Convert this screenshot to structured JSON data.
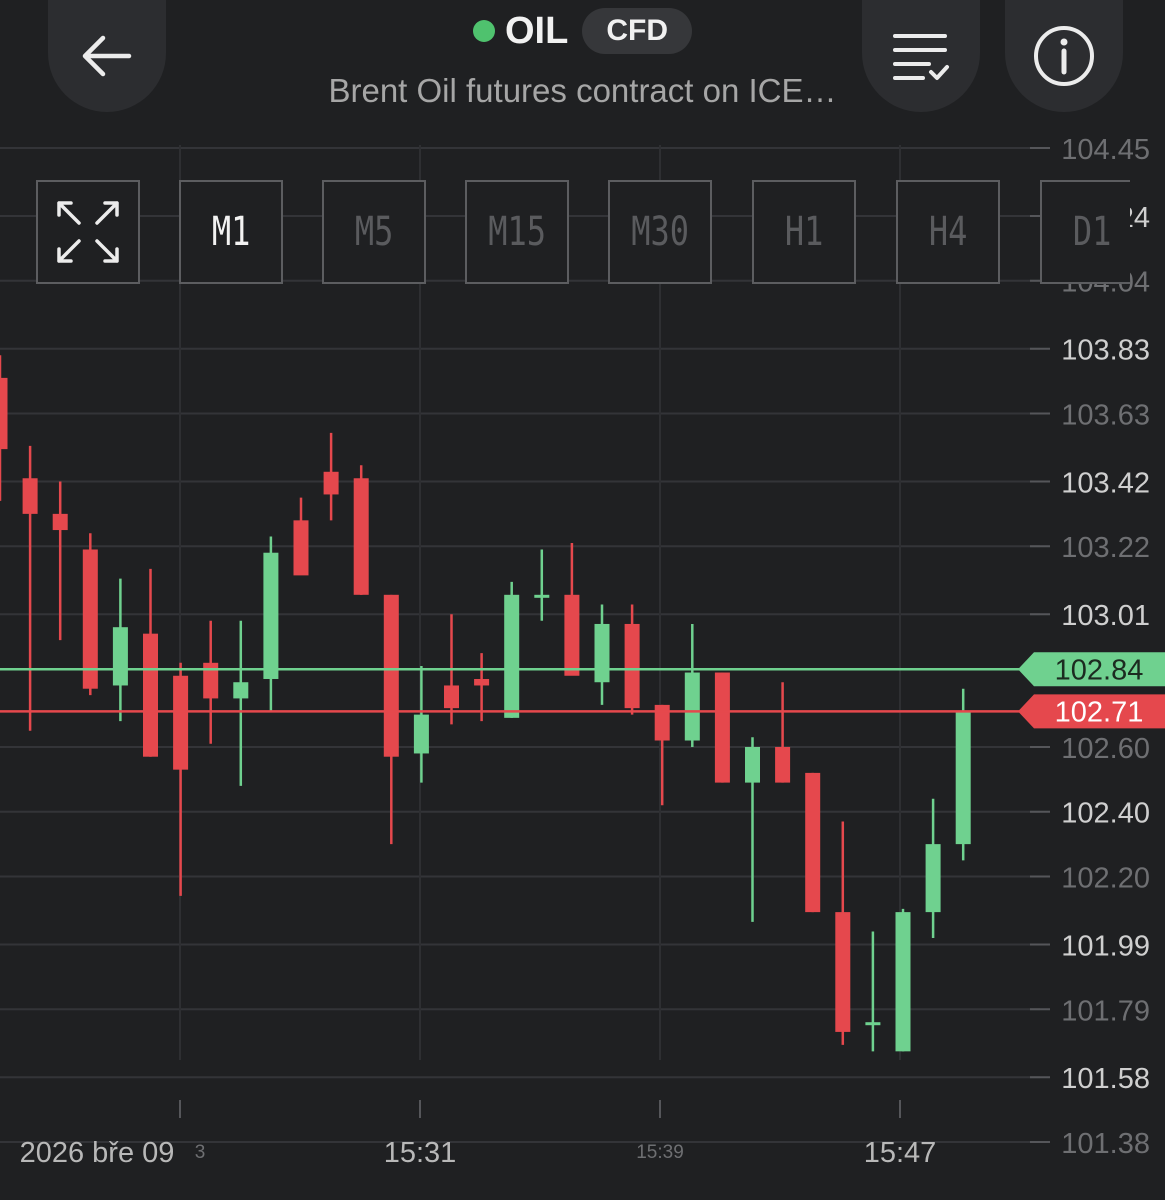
{
  "header": {
    "symbol": "OIL",
    "badge": "CFD",
    "subtitle": "Brent Oil futures contract on ICE…",
    "status_color": "#4fc26e"
  },
  "toolbar": {
    "timeframes": [
      "M1",
      "M5",
      "M15",
      "M30",
      "H1",
      "H4",
      "D1"
    ],
    "active": "M1"
  },
  "chart_data": {
    "type": "candlestick",
    "y_ticks": [
      "104.45",
      "104.24",
      "104.04",
      "103.83",
      "103.63",
      "103.42",
      "103.22",
      "103.01",
      "102.60",
      "102.40",
      "102.20",
      "101.99",
      "101.79",
      "101.58",
      "101.38"
    ],
    "y_range": [
      101.38,
      104.45
    ],
    "x_labels": [
      {
        "text": "2026 bře 09",
        "style": "major"
      },
      {
        "text": "3",
        "style": "minor"
      },
      {
        "text": "15:31",
        "style": "major"
      },
      {
        "text": "15:39",
        "style": "minor"
      },
      {
        "text": "15:47",
        "style": "major"
      }
    ],
    "ask": {
      "value": "102.84",
      "color": "#6fd18f"
    },
    "bid": {
      "value": "102.71",
      "color": "#e5484d"
    },
    "colors": {
      "up": "#6fd18f",
      "down": "#e5484d"
    },
    "candles": [
      {
        "o": 103.74,
        "h": 103.81,
        "l": 103.36,
        "c": 103.52
      },
      {
        "o": 103.43,
        "h": 103.53,
        "l": 102.65,
        "c": 103.32
      },
      {
        "o": 103.32,
        "h": 103.42,
        "l": 102.93,
        "c": 103.27
      },
      {
        "o": 103.21,
        "h": 103.26,
        "l": 102.76,
        "c": 102.78
      },
      {
        "o": 102.79,
        "h": 103.12,
        "l": 102.68,
        "c": 102.97
      },
      {
        "o": 102.95,
        "h": 103.15,
        "l": 102.57,
        "c": 102.57
      },
      {
        "o": 102.82,
        "h": 102.86,
        "l": 102.14,
        "c": 102.53
      },
      {
        "o": 102.86,
        "h": 102.99,
        "l": 102.61,
        "c": 102.75
      },
      {
        "o": 102.75,
        "h": 102.99,
        "l": 102.48,
        "c": 102.8
      },
      {
        "o": 102.81,
        "h": 103.25,
        "l": 102.71,
        "c": 103.2
      },
      {
        "o": 103.3,
        "h": 103.37,
        "l": 103.14,
        "c": 103.13
      },
      {
        "o": 103.45,
        "h": 103.57,
        "l": 103.3,
        "c": 103.38
      },
      {
        "o": 103.43,
        "h": 103.47,
        "l": 103.07,
        "c": 103.07
      },
      {
        "o": 103.07,
        "h": 103.07,
        "l": 102.3,
        "c": 102.57
      },
      {
        "o": 102.58,
        "h": 102.85,
        "l": 102.49,
        "c": 102.7
      },
      {
        "o": 102.79,
        "h": 103.01,
        "l": 102.67,
        "c": 102.72
      },
      {
        "o": 102.81,
        "h": 102.89,
        "l": 102.68,
        "c": 102.79
      },
      {
        "o": 102.69,
        "h": 103.11,
        "l": 102.69,
        "c": 103.07
      },
      {
        "o": 103.07,
        "h": 103.21,
        "l": 102.99,
        "c": 103.07
      },
      {
        "o": 103.07,
        "h": 103.23,
        "l": 102.85,
        "c": 102.82
      },
      {
        "o": 102.8,
        "h": 103.04,
        "l": 102.73,
        "c": 102.98
      },
      {
        "o": 102.98,
        "h": 103.04,
        "l": 102.7,
        "c": 102.72
      },
      {
        "o": 102.73,
        "h": 102.73,
        "l": 102.42,
        "c": 102.62
      },
      {
        "o": 102.62,
        "h": 102.98,
        "l": 102.6,
        "c": 102.83
      },
      {
        "o": 102.83,
        "h": 102.83,
        "l": 102.49,
        "c": 102.49
      },
      {
        "o": 102.49,
        "h": 102.63,
        "l": 102.06,
        "c": 102.6
      },
      {
        "o": 102.6,
        "h": 102.8,
        "l": 102.49,
        "c": 102.49
      },
      {
        "o": 102.52,
        "h": 102.52,
        "l": 102.09,
        "c": 102.09
      },
      {
        "o": 102.09,
        "h": 102.37,
        "l": 101.68,
        "c": 101.72
      },
      {
        "o": 101.75,
        "h": 102.03,
        "l": 101.66,
        "c": 101.75
      },
      {
        "o": 101.66,
        "h": 102.1,
        "l": 101.66,
        "c": 102.09
      },
      {
        "o": 102.09,
        "h": 102.44,
        "l": 102.01,
        "c": 102.3
      },
      {
        "o": 102.3,
        "h": 102.78,
        "l": 102.25,
        "c": 102.71
      }
    ]
  }
}
